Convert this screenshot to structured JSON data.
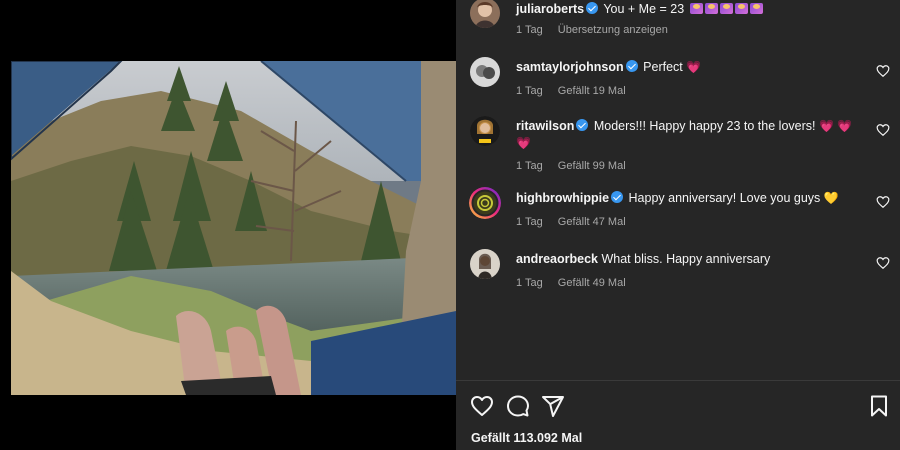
{
  "post": {
    "comments": [
      {
        "username": "juliaroberts",
        "verified": true,
        "text": "You + Me = 23",
        "emoji_count": 5,
        "time": "1 Tag",
        "extra": "Übersetzung anzeigen",
        "likeable": false
      },
      {
        "username": "samtaylorjohnson",
        "verified": true,
        "text": "Perfect",
        "hearts": "💗",
        "time": "1 Tag",
        "likes": "Gefällt 19 Mal",
        "likeable": true
      },
      {
        "username": "ritawilson",
        "verified": true,
        "text": "Moders!!! Happy happy 23 to the lovers!",
        "hearts": "💗 💗 💗",
        "time": "1 Tag",
        "likes": "Gefällt 99 Mal",
        "likeable": true
      },
      {
        "username": "highbrowhippie",
        "verified": true,
        "text": "Happy anniversary! Love you guys",
        "hearts": "💛",
        "time": "1 Tag",
        "likes": "Gefällt 47 Mal",
        "likeable": true
      },
      {
        "username": "andreaorbeck",
        "verified": false,
        "text": "What bliss. Happy anniversary",
        "time": "1 Tag",
        "likes": "Gefällt 49 Mal",
        "likeable": true
      }
    ],
    "total_likes": "Gefällt 113.092 Mal"
  },
  "icons": [
    "heart-icon",
    "comment-icon",
    "share-icon",
    "bookmark-icon"
  ],
  "colors": {
    "panel_bg": "#262626",
    "verified": "#3897f0",
    "meta_text": "#a8a8a8",
    "heart": "#ff3b6b"
  }
}
